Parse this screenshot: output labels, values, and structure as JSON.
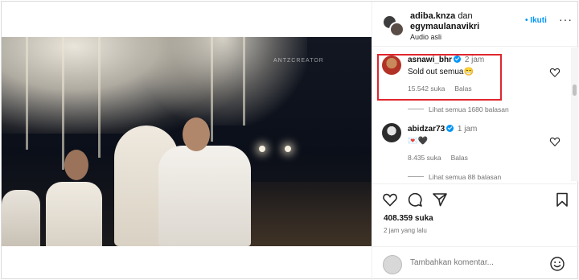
{
  "post": {
    "authors": [
      "adiba.knza",
      "egymaulanavikri"
    ],
    "authors_joiner": "dan",
    "audio": "Audio asli",
    "follow_label": "Ikuti",
    "follow_bullet": "•",
    "more_label": "···"
  },
  "video": {
    "watermark": "ANTZCREATOR"
  },
  "comments": [
    {
      "username": "asnawi_bhr",
      "time": "2 jam",
      "text": "Sold out semua😁",
      "likes": "15.542 suka",
      "reply_label": "Balas",
      "view_replies": "Lihat semua 1680 balasan",
      "highlighted": true
    },
    {
      "username": "abidzar73",
      "time": "1 jam",
      "text": "💌🖤",
      "likes": "8.435 suka",
      "reply_label": "Balas",
      "view_replies": "Lihat semua 88 balasan",
      "highlighted": false
    }
  ],
  "actions": {
    "like_count": "408.359 suka",
    "posted_ago": "2 jam yang lalu"
  },
  "composer": {
    "placeholder": "Tambahkan komentar..."
  },
  "colors": {
    "accent": "#0095f6",
    "highlight": "#e0262e",
    "muted": "#737373"
  },
  "icons": [
    "heart-icon",
    "comment-icon",
    "share-icon",
    "bookmark-icon",
    "user-tag-icon",
    "mute-icon",
    "emoji-icon",
    "more-icon",
    "verified-icon"
  ]
}
